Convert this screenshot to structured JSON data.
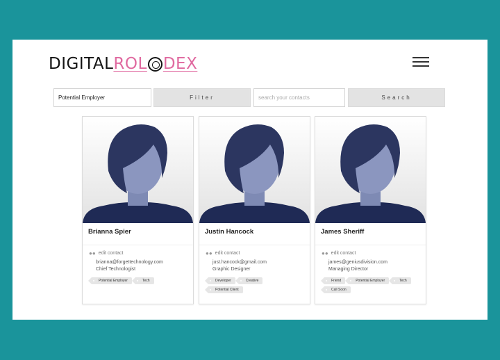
{
  "logo": {
    "part1": "DIGITAL ",
    "part2": "ROL",
    "part3": "DEX"
  },
  "colors": {
    "background": "#1a949b",
    "accent": "#e06aa0",
    "avatar_hair": "#2c3660",
    "avatar_skin": "#8b96bf",
    "avatar_body": "#1f2a55"
  },
  "toolbar": {
    "filter_value": "Potential Employer",
    "filter_button": "Filter",
    "search_placeholder": "search your contacts",
    "search_button": "Search"
  },
  "cards": [
    {
      "name": "Brianna Spier",
      "edit_label": "edit contact",
      "email": "brianna@forgettechnology.com",
      "title": "Chief Technologist",
      "tags": [
        "Potential Employer",
        "Tech"
      ]
    },
    {
      "name": "Justin Hancock",
      "edit_label": "edit contact",
      "email": "just.hancock@gmail.com",
      "title": "Graphic Designer",
      "tags": [
        "Developer",
        "Creative",
        "Potential Client"
      ]
    },
    {
      "name": "James Sheriff",
      "edit_label": "edit contact",
      "email": "james@geniusdivision.com",
      "title": "Managing Director",
      "tags": [
        "Friend",
        "Potential Employer",
        "Tech",
        "Call Soon"
      ]
    }
  ],
  "icons": {
    "menu": "hamburger-menu-icon",
    "edit": "users-icon",
    "avatar": "avatar-placeholder-icon"
  }
}
